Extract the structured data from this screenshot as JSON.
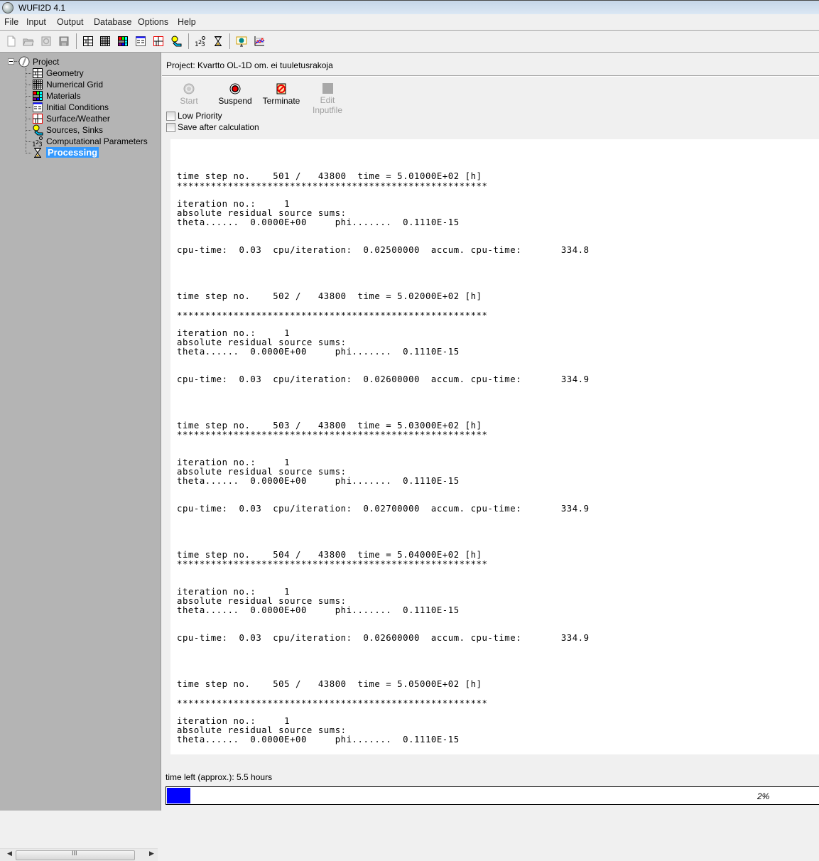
{
  "window": {
    "title": "WUFI2D 4.1"
  },
  "menu": [
    "File",
    "Input",
    "Output",
    "Database",
    "Options",
    "Help"
  ],
  "toolbar": {
    "buttons": [
      {
        "icon": "new-file-icon",
        "enabled": false
      },
      {
        "icon": "open-folder-icon",
        "enabled": false
      },
      {
        "icon": "refresh-icon",
        "enabled": false
      },
      {
        "icon": "save-icon",
        "enabled": false
      },
      {
        "icon": "geometry-icon",
        "enabled": true
      },
      {
        "icon": "numerical-grid-icon",
        "enabled": true
      },
      {
        "icon": "materials-icon",
        "enabled": true
      },
      {
        "icon": "initial-conditions-icon",
        "enabled": true
      },
      {
        "icon": "surface-weather-icon",
        "enabled": true
      },
      {
        "icon": "sources-sinks-icon",
        "enabled": true
      },
      {
        "icon": "computational-parameters-icon",
        "enabled": true
      },
      {
        "icon": "processing-hourglass-icon",
        "enabled": true
      },
      {
        "icon": "film-viewer-icon",
        "enabled": true
      },
      {
        "icon": "graph-icon",
        "enabled": true
      }
    ]
  },
  "tree": {
    "root": "Project",
    "items": [
      {
        "label": "Geometry",
        "icon": "geometry-icon"
      },
      {
        "label": "Numerical Grid",
        "icon": "numerical-grid-icon"
      },
      {
        "label": "Materials",
        "icon": "materials-icon"
      },
      {
        "label": "Initial Conditions",
        "icon": "initial-conditions-icon"
      },
      {
        "label": "Surface/Weather",
        "icon": "surface-weather-icon"
      },
      {
        "label": "Sources, Sinks",
        "icon": "sources-sinks-icon"
      },
      {
        "label": "Computational Parameters",
        "icon": "computational-parameters-icon"
      },
      {
        "label": "Processing",
        "icon": "processing-hourglass-icon",
        "selected": true
      }
    ]
  },
  "project": {
    "label": "Project: Kvartto OL-1D om. ei tuuletusrakoja"
  },
  "run_controls": {
    "start": {
      "label": "Start",
      "enabled": false
    },
    "suspend": {
      "label": "Suspend",
      "enabled": true
    },
    "terminate": {
      "label": "Terminate",
      "enabled": true
    },
    "edit_inputfile": {
      "label": "Edit Inputfile",
      "enabled": false
    }
  },
  "options": {
    "low_priority": {
      "label": "Low Priority",
      "checked": false
    },
    "save_after": {
      "label": "Save after calculation",
      "checked": false
    }
  },
  "log": {
    "stars": "*******************************************************",
    "absolute_label": "absolute residual source sums:",
    "blocks": [
      {
        "step": "time step no.    501 /   43800  time = 5.01000E+02 [h]",
        "iteration": "iteration no.:     1",
        "theta": "theta......  0.0000E+00     phi.......  0.1110E-15",
        "cpu": "cpu-time:  0.03  cpu/iteration:  0.02500000  accum. cpu-time:       334.8"
      },
      {
        "step": "time step no.    502 /   43800  time = 5.02000E+02 [h]",
        "iteration": "iteration no.:     1",
        "theta": "theta......  0.0000E+00     phi.......  0.1110E-15",
        "cpu": "cpu-time:  0.03  cpu/iteration:  0.02600000  accum. cpu-time:       334.9"
      },
      {
        "step": "time step no.    503 /   43800  time = 5.03000E+02 [h]",
        "iteration": "iteration no.:     1",
        "theta": "theta......  0.0000E+00     phi.......  0.1110E-15",
        "cpu": "cpu-time:  0.03  cpu/iteration:  0.02700000  accum. cpu-time:       334.9"
      },
      {
        "step": "time step no.    504 /   43800  time = 5.04000E+02 [h]",
        "iteration": "iteration no.:     1",
        "theta": "theta......  0.0000E+00     phi.......  0.1110E-15",
        "cpu": "cpu-time:  0.03  cpu/iteration:  0.02600000  accum. cpu-time:       334.9"
      },
      {
        "step": "time step no.    505 /   43800  time = 5.05000E+02 [h]",
        "iteration": "iteration no.:     1",
        "theta": "theta......  0.0000E+00     phi.......  0.1110E-15",
        "cpu": null
      }
    ]
  },
  "status": {
    "time_left": "time left (approx.): 5.5 hours",
    "progress_percent": 2,
    "progress_text": "2%"
  },
  "colors": {
    "progress_fill": "#0000ff",
    "selection": "#3399ff",
    "tree_bg": "#b4b4b4"
  }
}
